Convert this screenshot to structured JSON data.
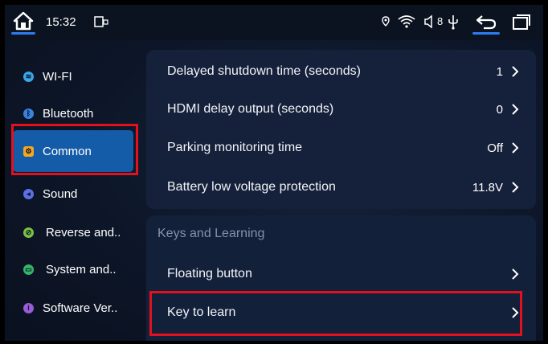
{
  "status_bar": {
    "time": "15:32",
    "right_indicator": "8",
    "icons": [
      "home-icon",
      "screen-mirror-icon",
      "location-icon",
      "wifi-icon",
      "volume-icon",
      "usb-icon",
      "back-icon",
      "recent-apps-icon"
    ]
  },
  "sidebar": {
    "items": [
      {
        "label": "WI-FI",
        "icon": "wifi-icon",
        "color": "#3aa8e8"
      },
      {
        "label": "Bluetooth",
        "icon": "bluetooth-icon",
        "color": "#3b82e0"
      },
      {
        "label": "Common",
        "icon": "gear-icon",
        "color": "#f5a623"
      },
      {
        "label": "Sound",
        "icon": "speaker-icon",
        "color": "#5b6fe6"
      },
      {
        "label": "Reverse and..",
        "icon": "reverse-icon",
        "color": "#7ac043"
      },
      {
        "label": "System and..",
        "icon": "system-icon",
        "color": "#35b46b"
      },
      {
        "label": "Software Ver..",
        "icon": "info-icon",
        "color": "#9a5bd6"
      }
    ],
    "active_index": 2
  },
  "settings": {
    "rows": [
      {
        "label": "Delayed shutdown time (seconds)",
        "value": "1"
      },
      {
        "label": "HDMI delay output (seconds)",
        "value": "0"
      },
      {
        "label": "Parking monitoring time",
        "value": "Off"
      },
      {
        "label": "Battery low voltage protection",
        "value": "11.8V"
      }
    ],
    "section_title": "Keys and Learning",
    "section_rows": [
      {
        "label": "Floating button",
        "value": ""
      },
      {
        "label": "Key to learn",
        "value": ""
      }
    ]
  },
  "colors": {
    "accent": "#2d7df0",
    "active_item": "#155ca8",
    "highlight": "#e3101e"
  }
}
